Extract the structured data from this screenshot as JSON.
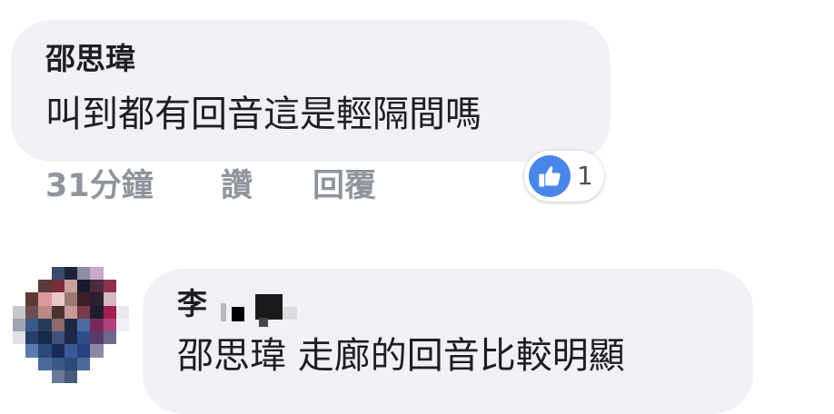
{
  "comments": [
    {
      "author": "邵思瑋",
      "text": "叫到都有回音這是輕隔間嗎",
      "time": "31分鐘",
      "like_label": "讚",
      "reply_label": "回覆",
      "reaction_count": "1",
      "reaction_icon": "thumbs-up-icon"
    },
    {
      "author": "李",
      "text": "邵思瑋 走廊的回音比較明顯",
      "avatar_icon": "pixelated-avatar-icon"
    }
  ],
  "colors": {
    "bubble": "#f0f1f5",
    "meta_text": "#90949c",
    "like_blue": "#4a86e8",
    "text": "#1c1e21"
  }
}
